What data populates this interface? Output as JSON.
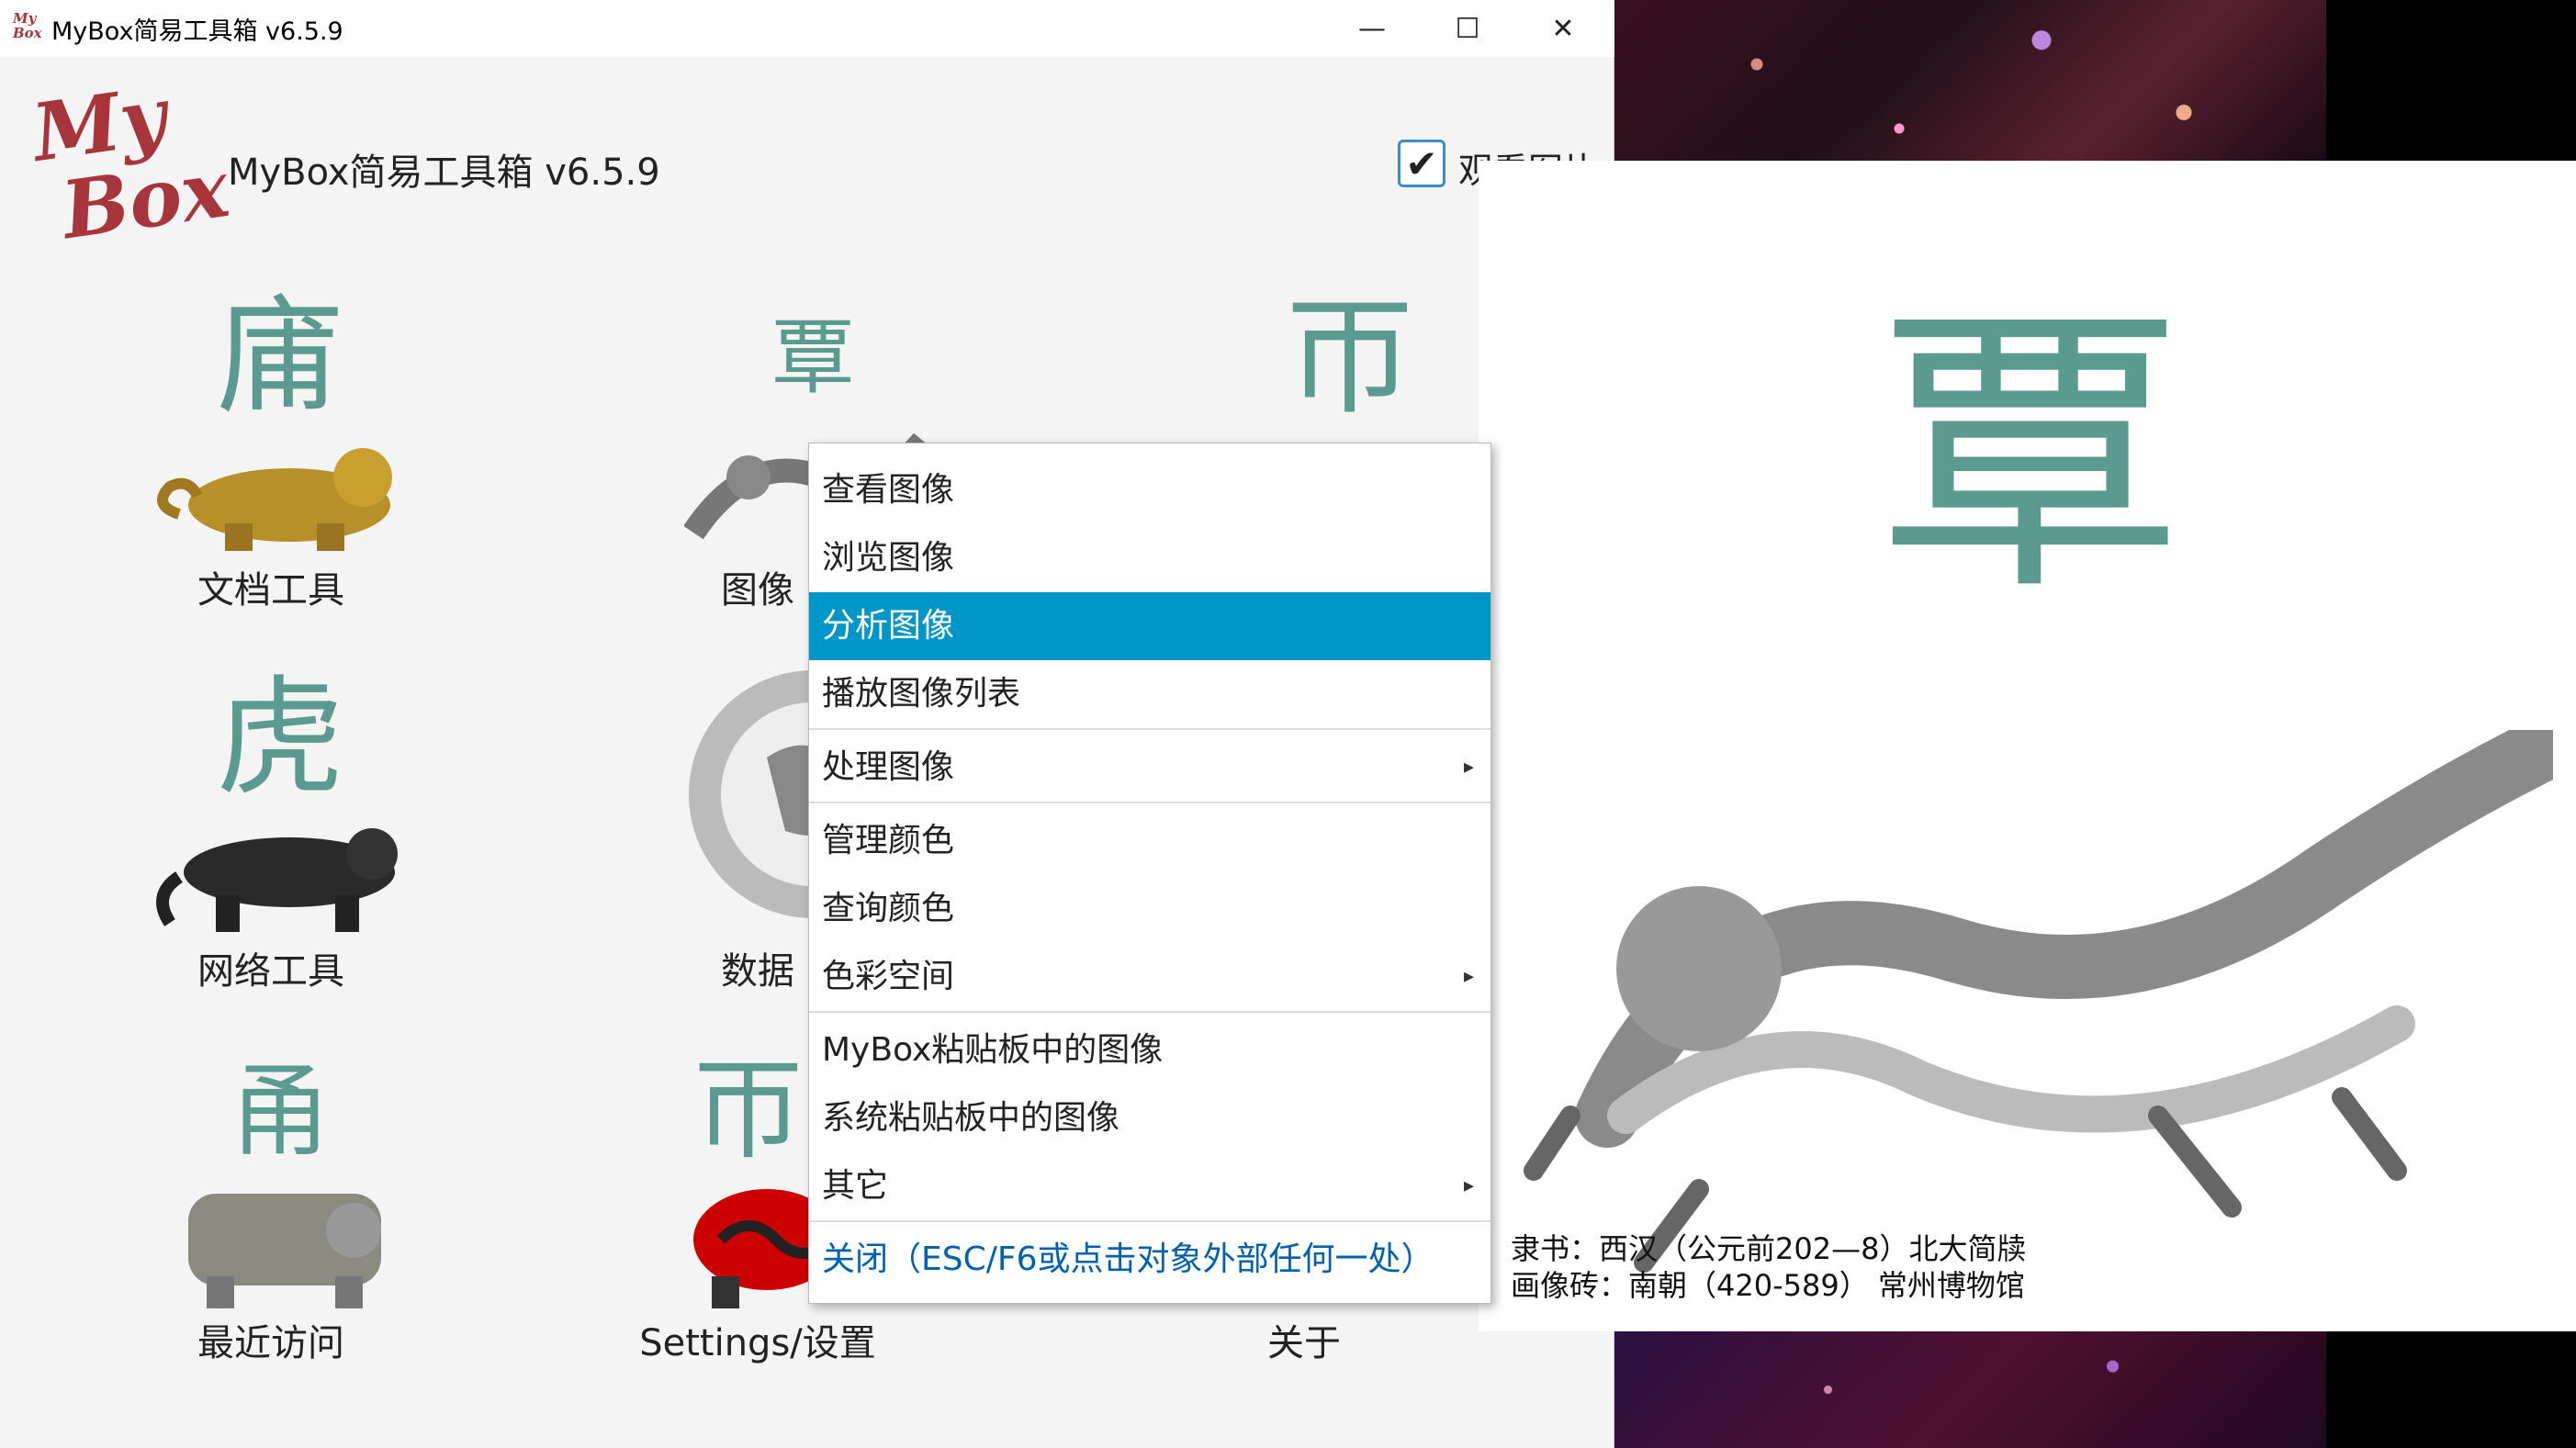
{
  "window": {
    "title": "MyBox简易工具箱 v6.5.9",
    "logo_text_line1": "My",
    "logo_text_line2": "Box",
    "controls": {
      "minimize": "—",
      "maximize": "☐",
      "close": "✕"
    }
  },
  "header": {
    "title": "MyBox简易工具箱 v6.5.9",
    "show_image_checkbox": {
      "checked": true,
      "mark": "✔",
      "label": "观看图片"
    }
  },
  "tiles": [
    {
      "label": "文档工具",
      "glyph": "庯"
    },
    {
      "label": "图像",
      "glyph": "覃"
    },
    {
      "label": "",
      "glyph": "帀"
    },
    {
      "label": "网络工具",
      "glyph": "虎"
    },
    {
      "label": "数据",
      "glyph": ""
    },
    {
      "label": "",
      "glyph": ""
    },
    {
      "label": "最近访问",
      "glyph": "甬"
    },
    {
      "label": "Settings/设置",
      "glyph": "帀"
    },
    {
      "label": "关于",
      "glyph": ""
    }
  ],
  "preview": {
    "glyph": "覃",
    "caption_line1": "隶书：西汉（公元前202—8）北大简牍",
    "caption_line2": "画像砖：南朝（420-589） 常州博物馆"
  },
  "menu": {
    "items": [
      {
        "label": "查看图像"
      },
      {
        "label": "浏览图像"
      },
      {
        "label": "分析图像",
        "active": true
      },
      {
        "label": "播放图像列表"
      },
      {
        "label": "处理图像",
        "submenu": true
      },
      {
        "label": "管理颜色"
      },
      {
        "label": "查询颜色"
      },
      {
        "label": "色彩空间",
        "submenu": true
      },
      {
        "label": "MyBox粘贴板中的图像"
      },
      {
        "label": "系统粘贴板中的图像"
      },
      {
        "label": "其它",
        "submenu": true
      },
      {
        "label": "关闭（ESC/F6或点击对象外部任何一处）"
      }
    ],
    "submenu_arrow": "▸"
  },
  "colors": {
    "highlight": "#0096c9",
    "glyph_teal": "#5a9a90",
    "logo_red": "#a8343c",
    "close_link": "#0060b0"
  }
}
